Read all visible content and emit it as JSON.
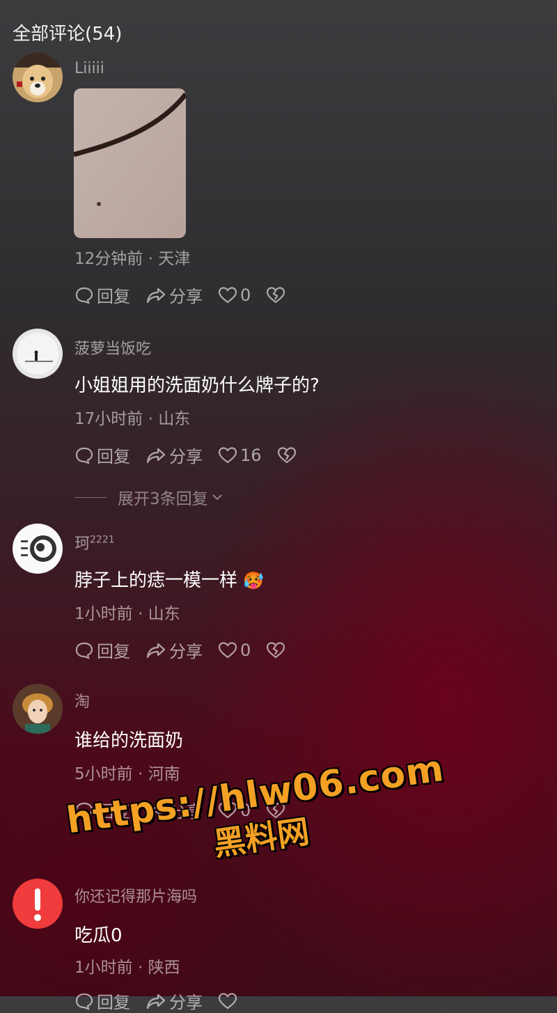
{
  "header": {
    "title": "全部评论(54)"
  },
  "comments": [
    {
      "username": "Liiiii",
      "text": "",
      "meta": "12分钟前 · 天津",
      "reply": "回复",
      "share": "分享",
      "likes": "0"
    },
    {
      "username": "菠萝当饭吃",
      "text": "小姐姐用的洗面奶什么牌子的?",
      "meta": "17小时前 · 山东",
      "reply": "回复",
      "share": "分享",
      "likes": "16",
      "expand": "展开3条回复"
    },
    {
      "username": "珂",
      "username_sup": "2221",
      "text": "脖子上的痣一模一样",
      "emoji": "🥵",
      "meta": "1小时前 · 山东",
      "reply": "回复",
      "share": "分享",
      "likes": "0"
    },
    {
      "username": "淘",
      "text": "谁给的洗面奶",
      "meta": "5小时前 · 河南",
      "reply": "回复",
      "share": "分享",
      "likes": "0"
    },
    {
      "username": "你还记得那片海吗",
      "text": "吃瓜0",
      "meta": "1小时前 · 陕西",
      "reply": "回复",
      "share": "分享",
      "likes": ""
    }
  ],
  "watermark": {
    "url": "https://hlw06.com",
    "name": "黑料网"
  },
  "icons": {
    "reply": "comment-bubble-icon",
    "share": "share-arrow-icon",
    "like": "heart-icon",
    "dislike": "broken-heart-icon",
    "alert": "exclamation-icon"
  },
  "colors": {
    "alert_red": "#f03c3c",
    "watermark_orange": "#f3a024"
  }
}
